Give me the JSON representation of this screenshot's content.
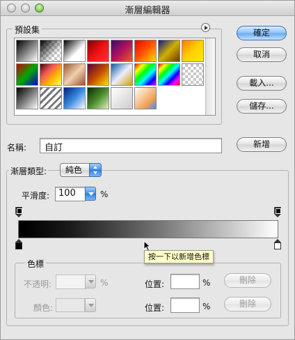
{
  "window": {
    "title": "漸層編輯器"
  },
  "presets": {
    "legend": "預設集",
    "menu_icon": "flyout-menu-icon",
    "rows": [
      [
        "linear-gradient(135deg,#000,#fff)",
        "transparent-checker-black",
        "linear-gradient(135deg,#000,#fff 60%,#fff)",
        "linear-gradient(135deg,#7a0000,#e11,#f33)",
        "linear-gradient(135deg,#3a0d6a,#b01060,#e86020)",
        "linear-gradient(135deg,#e00,#f50,#fd0)",
        "linear-gradient(135deg,#0a1a8a,#d0b000,#6a3a00)",
        "linear-gradient(135deg,#ff7a00,#ffd000,#ffe900)"
      ],
      [
        "linear-gradient(135deg,#c00,#0a0,#00c)",
        "linear-gradient(135deg,#400,#e55,#fb0,#ff6)",
        "linear-gradient(135deg,#9a5a30,#f0d0b0,#a05030)",
        "linear-gradient(135deg,#5a0040,#c04a00,#ffe000)",
        "linear-gradient(135deg,#0a5aa0,#eef,#d0a000)",
        "linear-gradient(135deg,#f00,#ff0,#0f0,#0ff,#00f,#f0f)",
        "linear-gradient(135deg,#f00,#ff0,#0f0,#0ff,#00f,#f0f,#f00)",
        "stripes-black-white"
      ],
      [
        "linear-gradient(135deg,#000,#7a7a7a,#fff)",
        "stripes-gray-white",
        "linear-gradient(135deg,#00207a,#3a8ae0,#fff)",
        "linear-gradient(135deg,#0a2a0a,#4a8a2a,#e0f0c0)",
        "linear-gradient(135deg,#fff,#ccc)",
        "linear-gradient(135deg,#fff,#f0a050 70%,#48f)"
      ]
    ]
  },
  "buttons": {
    "ok": "確定",
    "cancel": "取消",
    "load": "載入...",
    "save": "儲存...",
    "new": "新增",
    "delete1": "刪除",
    "delete2": "刪除"
  },
  "name": {
    "label": "名稱:",
    "value": "自訂"
  },
  "gradient_type": {
    "label": "漸層類型:",
    "selected": "純色",
    "smoothness_label": "平滑度:",
    "smoothness_value": "100",
    "smoothness_unit": "%"
  },
  "gradient": {
    "opacity_stops": [
      0,
      1
    ],
    "color_stops": [
      {
        "position": 0,
        "color": "#000000"
      },
      {
        "position": 1,
        "color": "#ffffff"
      }
    ]
  },
  "tooltip": "按一下以新增色標",
  "stops": {
    "legend": "色標",
    "opacity_label": "不透明:",
    "opacity_unit": "%",
    "color_label": "顏色:",
    "location_label1": "位置:",
    "location_unit1": "%",
    "location_label2": "位置:",
    "location_unit2": "%"
  }
}
